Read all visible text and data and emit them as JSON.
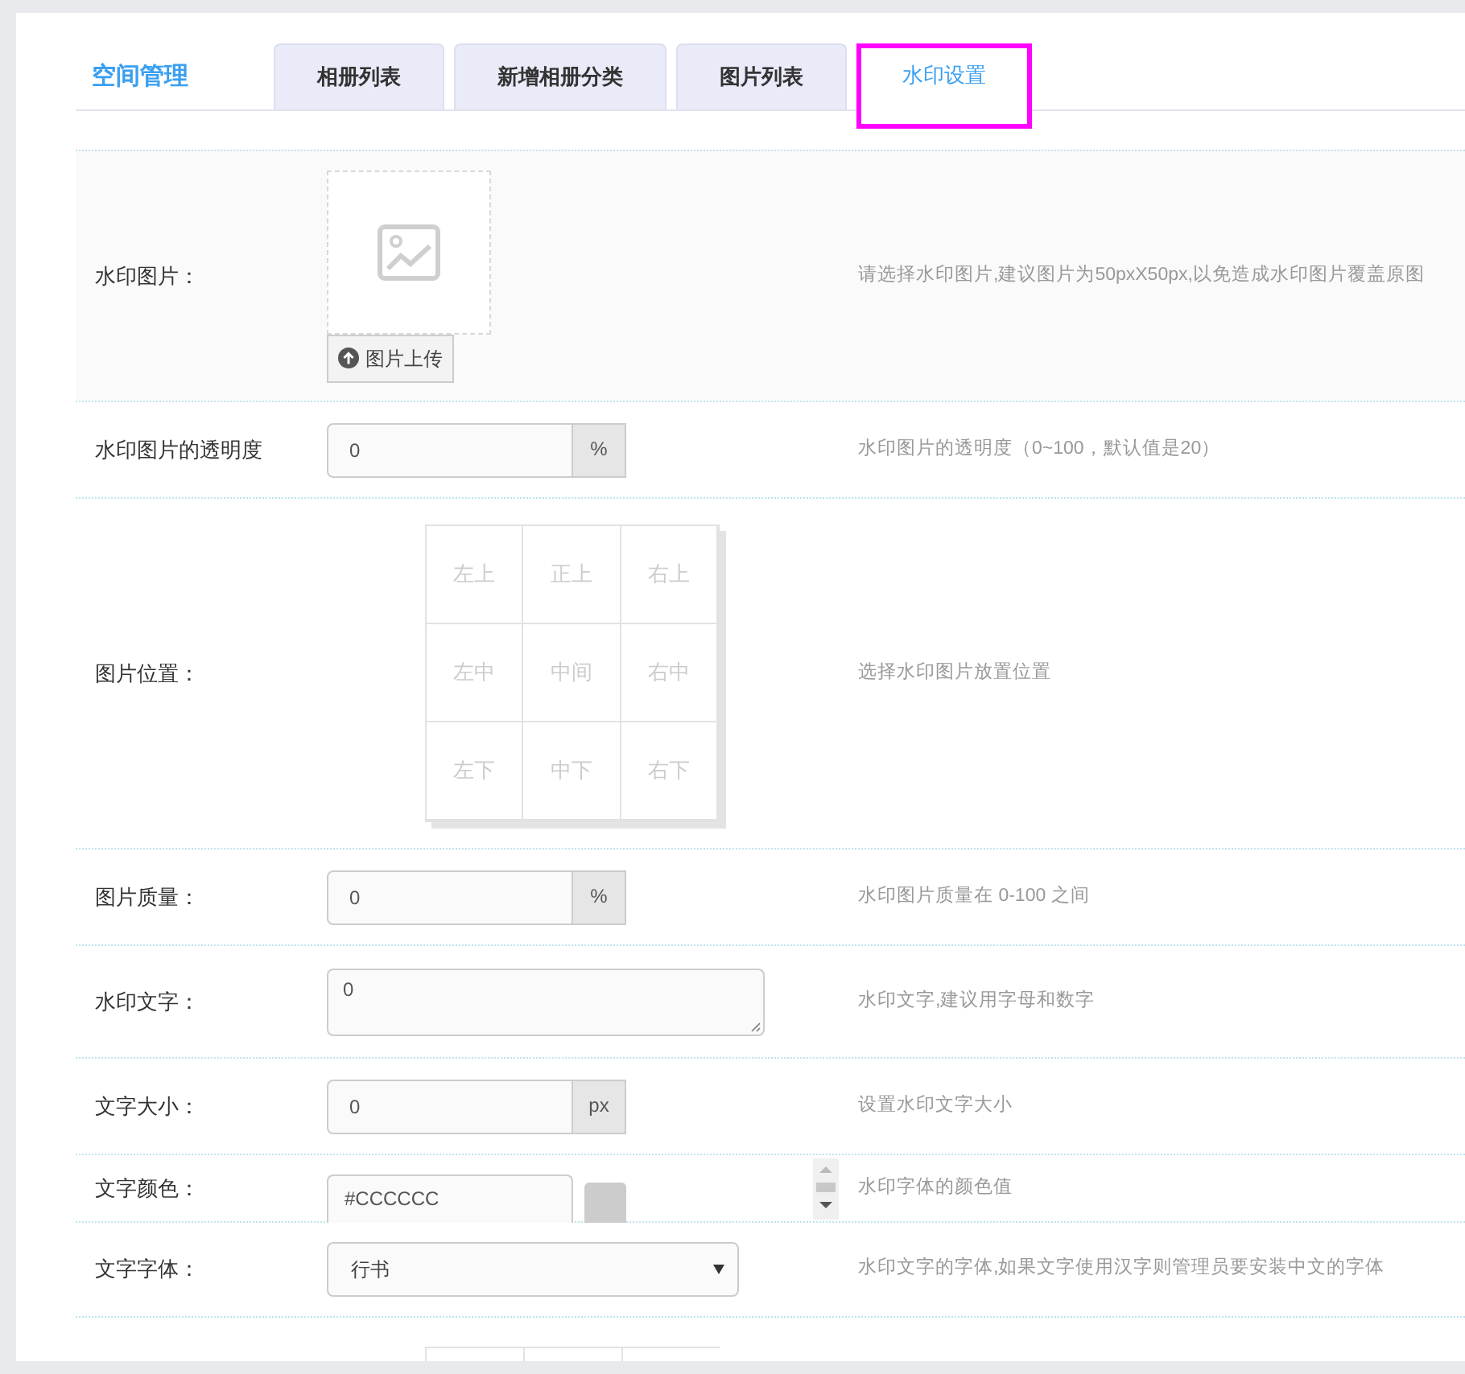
{
  "header": {
    "title": "空间管理"
  },
  "tabs": [
    {
      "label": "相册列表",
      "selected": false
    },
    {
      "label": "新增相册分类",
      "selected": false
    },
    {
      "label": "图片列表",
      "selected": false
    },
    {
      "label": "水印设置",
      "selected": true
    }
  ],
  "rows": [
    {
      "kind": "upload",
      "label": "水印图片：",
      "button": "图片上传",
      "hint": "请选择水印图片,建议图片为50pxX50px,以免造成水印图片覆盖原图"
    },
    {
      "kind": "addon",
      "label": "水印图片的透明度",
      "value": "0",
      "addon": "%",
      "hint": "水印图片的透明度（0~100，默认值是20）"
    },
    {
      "kind": "grid",
      "label": "图片位置：",
      "cells": [
        "左上",
        "正上",
        "右上",
        "左中",
        "中间",
        "右中",
        "左下",
        "中下",
        "右下"
      ],
      "hint": "选择水印图片放置位置"
    },
    {
      "kind": "addon",
      "label": "图片质量：",
      "value": "0",
      "addon": "%",
      "hint": "水印图片质量在 0-100 之间"
    },
    {
      "kind": "textarea",
      "label": "水印文字：",
      "value": "0",
      "hint": "水印文字,建议用字母和数字"
    },
    {
      "kind": "addon",
      "label": "文字大小：",
      "value": "0",
      "addon": "px",
      "hint": "设置水印文字大小"
    },
    {
      "kind": "color",
      "label": "文字颜色：",
      "value": "#CCCCCC",
      "color": "#cccccc",
      "hint": "水印字体的颜色值"
    },
    {
      "kind": "select",
      "label": "文字字体：",
      "value": "行书",
      "hint": "水印文字的字体,如果文字使用汉字则管理员要安装中文的字体"
    },
    {
      "kind": "gridcut"
    }
  ]
}
